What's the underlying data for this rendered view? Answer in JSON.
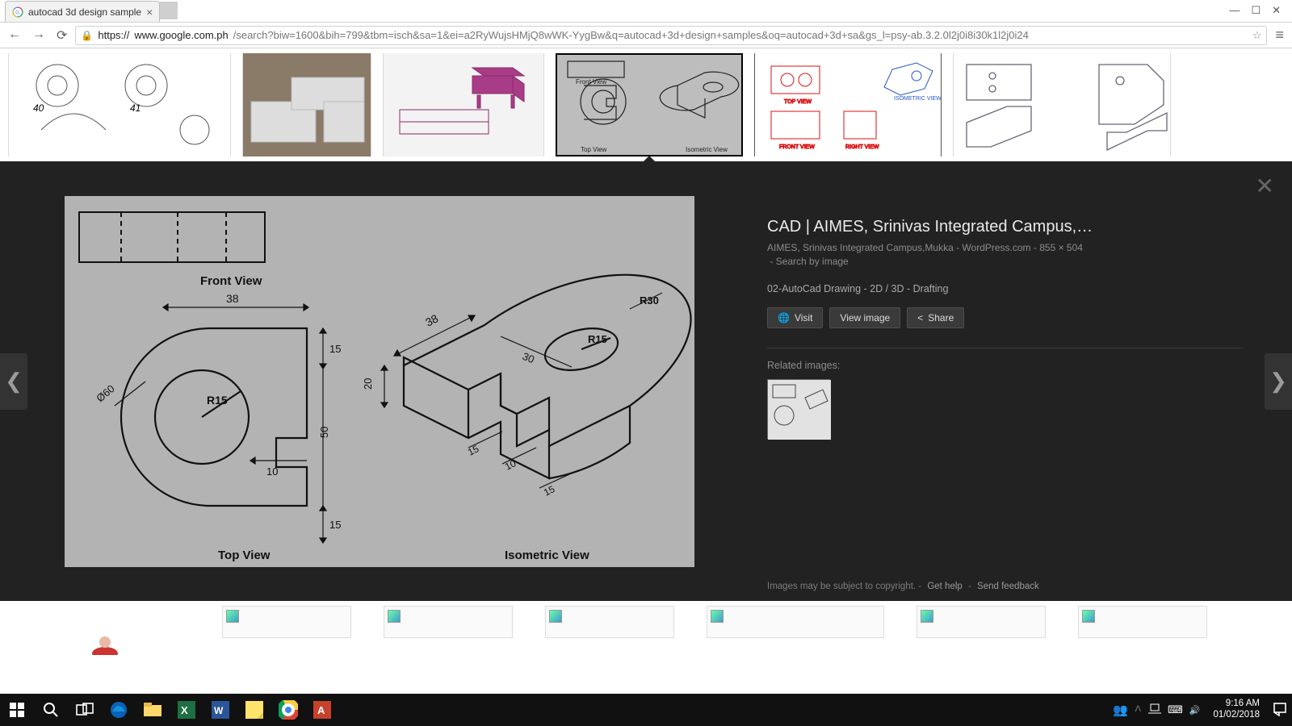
{
  "browser": {
    "tab_title": "autocad 3d design sample",
    "user_badge": "",
    "addr_protocol": "https://",
    "addr_host": "www.google.com.ph",
    "addr_path": "/search?biw=1600&bih=799&tbm=isch&sa=1&ei=a2RyWujsHMjQ8wWK-YygBw&q=autocad+3d+design+samples&oq=autocad+3d+sa&gs_l=psy-ab.3.2.0l2j0i8i30k1l2j0i24"
  },
  "viewer": {
    "title": "CAD | AIMES, Srinivas Integrated Campus,…",
    "source": "AIMES, Srinivas Integrated Campus,Mukka - WordPress.com",
    "dims": "855 × 504",
    "search_by_image": "Search by image",
    "description": "02-AutoCad Drawing - 2D / 3D - Drafting",
    "btn_visit": "Visit",
    "btn_view": "View image",
    "btn_share": "Share",
    "related_label": "Related images:",
    "foot_notice": "Images may be subject to copyright.",
    "foot_help": "Get help",
    "foot_feedback": "Send feedback"
  },
  "drawing": {
    "front_view_label": "Front View",
    "top_view_label": "Top View",
    "iso_label": "Isometric View",
    "dim_38": "38",
    "dim_15a": "15",
    "dim_15b": "15",
    "dim_10a": "10",
    "dim_10b": "10",
    "dim_50": "50",
    "dim_30": "30",
    "dim_20": "20",
    "dim_r15": "R15",
    "dim_r15b": "R15",
    "dim_r30": "R30",
    "dim_phi60": "Ø60",
    "dim_iso15": "15"
  },
  "taskbar": {
    "time": "9:16 AM",
    "date": "01/02/2018"
  }
}
